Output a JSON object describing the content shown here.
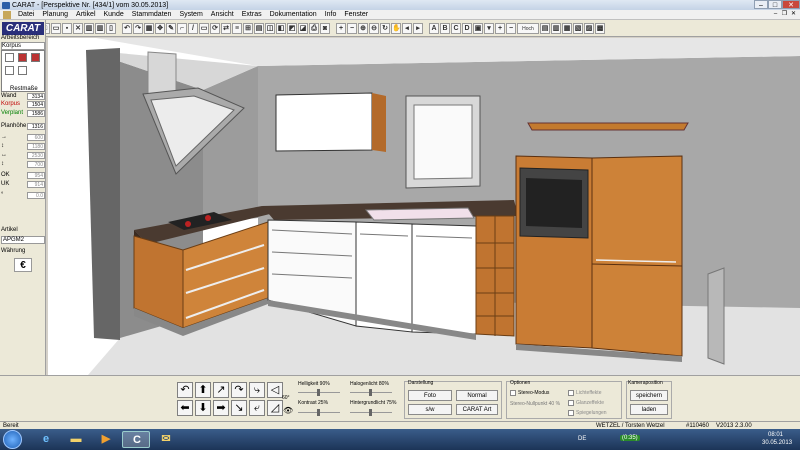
{
  "window": {
    "title": "CARAT - [Perspektive Nr. [434/1] vom 30.05.2013]"
  },
  "menu": [
    "Datei",
    "Planung",
    "Artikel",
    "Kunde",
    "Stammdaten",
    "System",
    "Ansicht",
    "Extras",
    "Dokumentation",
    "Info",
    "Fenster"
  ],
  "toolbar": {
    "letters": [
      "A",
      "B",
      "C",
      "D"
    ],
    "dropdown": "Hoch"
  },
  "left_panel": {
    "logo": "CARAT",
    "arbeitsbereich": "Arbeitsbereich",
    "korpus": "Korpus",
    "restmasse": "Restmaße",
    "rows": [
      {
        "key": "Wand",
        "value": "3134",
        "color": "#000000"
      },
      {
        "key": "Korpus",
        "value": "1504",
        "color": "#c00000"
      },
      {
        "key": "Verplant",
        "value": "1586",
        "color": "#008000"
      }
    ],
    "planhoehe_label": "Planhöhe",
    "planhoehe": "1316",
    "dim_rows": [
      {
        "key": "→",
        "value": "600"
      },
      {
        "key": "↕",
        "value": "1180"
      },
      {
        "key": "↔",
        "value": "2530"
      },
      {
        "key": "↕",
        "value": "700"
      }
    ],
    "ok_label": "OK",
    "ok_value": "954",
    "uk_label": "UK",
    "uk_value": "914",
    "degree_label": "°",
    "degree_value": "0.0",
    "artikel_label": "Artikel",
    "artikel_value": "APGM2",
    "waehrung_label": "Währung",
    "currency": "€"
  },
  "controls": {
    "helligkeit": "Helligkeit 90%",
    "kontrast": "Kontrast 25%",
    "halogenlicht": "Halogenlicht 80%",
    "hintergrundlicht": "Hintergrundlicht 75%",
    "angle": "60°",
    "darstellung_label": "Darstellung",
    "foto_label": "Foto",
    "normal_label": "Normal",
    "sw_label": "s/w",
    "carat_art_label": "CARAT Art",
    "optionen_label": "Optionen",
    "stereo_label": "Stereo-Modus",
    "stereo_sub": "Stereo-Nullpunkt 40 %",
    "lichteffekte": "Lichteffekte",
    "glanzeffekte": "Glanzeffekte",
    "spiegelungen": "Spiegelungen",
    "kamera_label": "Kameraposition",
    "speichern_label": "speichern",
    "laden_label": "laden"
  },
  "status": {
    "left": "Bereit",
    "user": "WETZEL / Torsten Wetzel",
    "id": "#110460",
    "version": "V2013 2.3.00"
  },
  "taskbar": {
    "tray_lang": "DE",
    "tray_timer": "(0:35)",
    "time": "08:01",
    "date": "30.05.2013"
  }
}
